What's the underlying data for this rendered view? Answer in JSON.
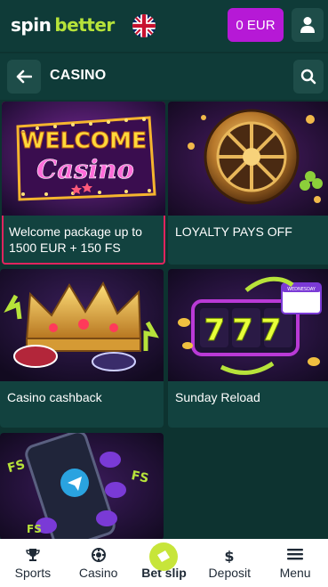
{
  "header": {
    "logo_part1": "spin",
    "logo_part2": "better",
    "balance_label": "0 EUR",
    "language_icon": "uk-flag-icon",
    "account_icon": "user-icon"
  },
  "subheader": {
    "back_icon": "arrow-left-icon",
    "title": "CASINO",
    "search_icon": "search-icon"
  },
  "promos": [
    {
      "caption": "Welcome package up to 1500 EUR + 150 FS",
      "art_text_1": "WELCOME",
      "art_text_2": "Casino"
    },
    {
      "caption": "LOYALTY PAYS OFF"
    },
    {
      "caption": "Casino cashback"
    },
    {
      "caption": "Sunday Reload",
      "art_text": "777",
      "tag": "WEDNESDAY"
    },
    {
      "caption": "",
      "art_text": "FS"
    }
  ],
  "bottom_nav": [
    {
      "label": "Sports",
      "icon": "trophy-icon"
    },
    {
      "label": "Casino",
      "icon": "casino-chip-icon"
    },
    {
      "label": "Bet slip",
      "icon": "ticket-icon"
    },
    {
      "label": "Deposit",
      "icon": "dollar-icon"
    },
    {
      "label": "Menu",
      "icon": "hamburger-icon"
    }
  ],
  "colors": {
    "background": "#0d3330",
    "header": "#0f3b38",
    "accent_purple": "#b619d6",
    "accent_lime": "#c7e53a",
    "selected_outline": "#e0245e"
  }
}
